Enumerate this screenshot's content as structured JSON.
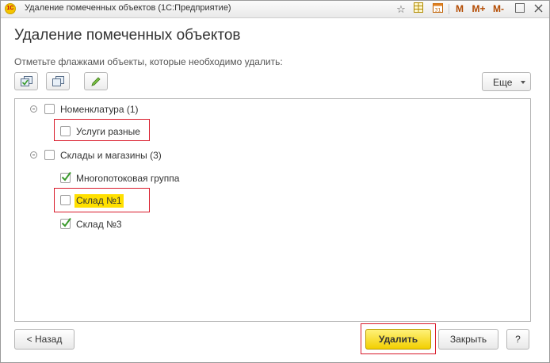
{
  "window": {
    "title": "Удаление помеченных объектов  (1С:Предприятие)",
    "titlebar_icons": [
      "star-icon",
      "spreadsheet-icon",
      "calendar-icon"
    ],
    "memory_buttons": [
      "M",
      "M+",
      "M-"
    ],
    "window_controls": [
      "minimize-icon",
      "close-icon"
    ]
  },
  "page": {
    "heading": "Удаление помеченных объектов",
    "instruction": "Отметьте флажками объекты, которые необходимо удалить:"
  },
  "toolbar": {
    "buttons": [
      "check-all-icon",
      "uncheck-all-icon",
      "edit-icon"
    ],
    "more_label": "Еще"
  },
  "tree": [
    {
      "label": "Номенклатура (1)",
      "checked": false,
      "level": 0,
      "expanded": true,
      "children": [
        {
          "label": "Услуги разные",
          "checked": false,
          "level": 1,
          "highlighted_box": true
        }
      ]
    },
    {
      "label": "Склады и магазины (3)",
      "checked": false,
      "level": 0,
      "expanded": true,
      "children": [
        {
          "label": "Многопотоковая группа",
          "checked": true,
          "level": 1
        },
        {
          "label": "Склад №1",
          "checked": false,
          "level": 1,
          "highlighted_box": true,
          "highlighted_text": true
        },
        {
          "label": "Склад №3",
          "checked": true,
          "level": 1
        }
      ]
    }
  ],
  "footer": {
    "back_label": "< Назад",
    "delete_label": "Удалить",
    "close_label": "Закрыть",
    "help_label": "?"
  },
  "colors": {
    "accent_yellow": "#f2cf00",
    "highlight_yellow": "#ffe000",
    "frame_red": "#d91a2a",
    "check_green": "#3a9a2c"
  }
}
